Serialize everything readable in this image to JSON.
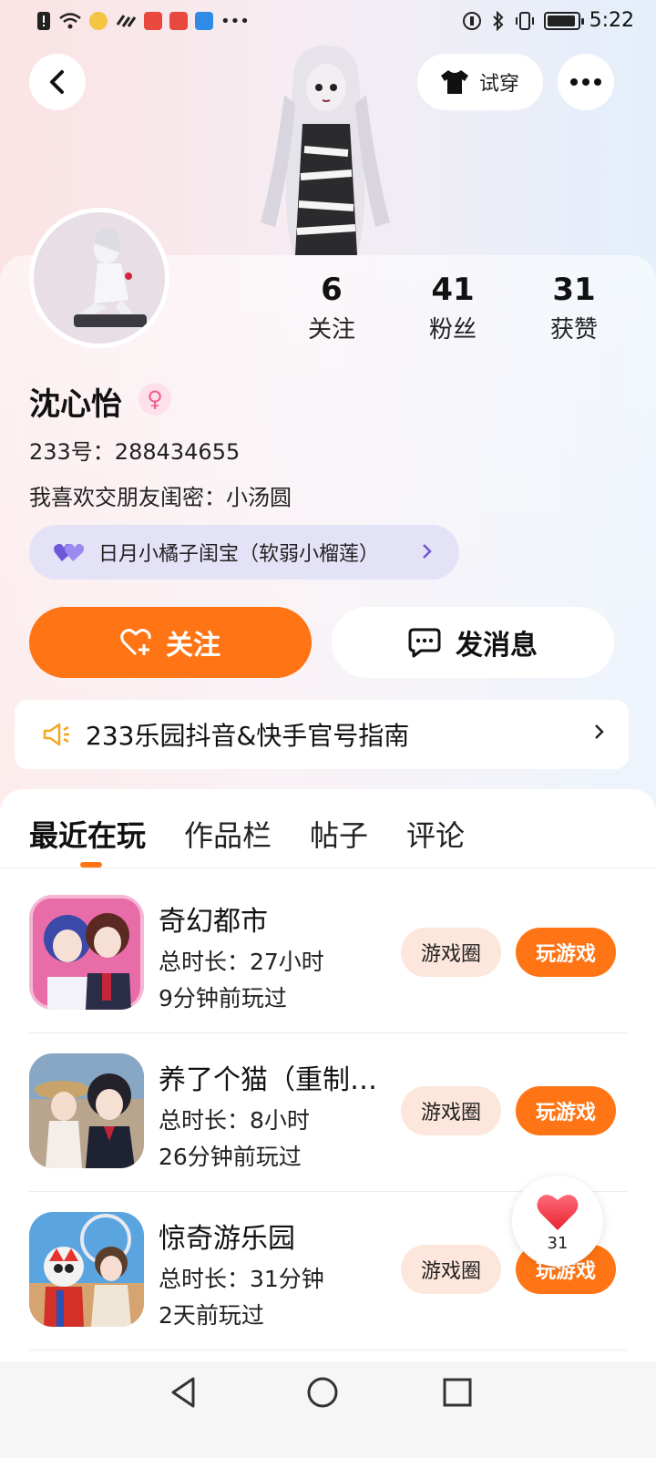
{
  "status_bar": {
    "time": "5:22"
  },
  "header": {
    "try_on_label": "试穿"
  },
  "profile": {
    "name": "沈心怡",
    "gender_symbol": "♀",
    "id_line": "233号：288434655",
    "bio": "我喜欢交朋友闺密：小汤圆",
    "bestie_badge": "日月小橘子闺宝（软弱小榴莲）",
    "stats": [
      {
        "value": "6",
        "label": "关注"
      },
      {
        "value": "41",
        "label": "粉丝"
      },
      {
        "value": "31",
        "label": "获赞"
      }
    ]
  },
  "actions": {
    "follow_label": "关注",
    "message_label": "发消息"
  },
  "notice": {
    "text": "233乐园抖音&快手官号指南"
  },
  "tabs": [
    {
      "label": "最近在玩",
      "active": true
    },
    {
      "label": "作品栏",
      "active": false
    },
    {
      "label": "帖子",
      "active": false
    },
    {
      "label": "评论",
      "active": false
    }
  ],
  "games": [
    {
      "title": "奇幻都市",
      "duration": "总时长：27小时",
      "last_played": "9分钟前玩过",
      "circle_label": "游戏圈",
      "play_label": "玩游戏"
    },
    {
      "title": "养了个猫（重制…",
      "duration": "总时长：8小时",
      "last_played": "26分钟前玩过",
      "circle_label": "游戏圈",
      "play_label": "玩游戏"
    },
    {
      "title": "惊奇游乐园",
      "duration": "总时长：31分钟",
      "last_played": "2天前玩过",
      "circle_label": "游戏圈",
      "play_label": "玩游戏"
    }
  ],
  "floating_like": {
    "count": "31"
  },
  "colors": {
    "accent": "#ff7414",
    "bestie_bg": "#e4e2f6",
    "circle_pill_bg": "#fde6dc"
  }
}
